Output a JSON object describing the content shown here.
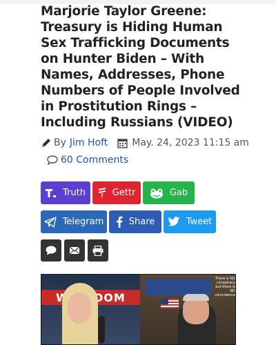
{
  "article": {
    "headline": "Marjorie Taylor Greene: Treasury is Hiding Human Sex Trafficking Documents on Hunter Biden – With Names, Addresses, Phone Numbers of People Involved in Prostitution Rings – Including Russians (VIDEO)",
    "byline_prefix": "By",
    "author": "Jim Hoft",
    "date": "May. 24, 2023 11:15 am",
    "comments": "60 Comments"
  },
  "share": {
    "truth": "Truth",
    "gettr": "Gettr",
    "gab": "Gab",
    "telegram": "Telegram",
    "share": "Share",
    "tweet": "Tweet"
  },
  "video": {
    "banner": "WELCOOM",
    "panel_text": "There is NO conspiracy but there is NO coincidence"
  },
  "colors": {
    "truth": "#5b3fd1",
    "gettr": "#e0242f",
    "gab": "#25b34b",
    "telegram": "#2b69b8",
    "facebook": "#2c5cb3",
    "twitter": "#1d9bf0",
    "link": "#2452a6",
    "dark_button": "#333333"
  },
  "icons": [
    "pencil-icon",
    "calendar-icon",
    "comment-bubble-icon",
    "truth-logo-icon",
    "gettr-logo-icon",
    "gab-frog-icon",
    "telegram-plane-icon",
    "facebook-f-icon",
    "twitter-bird-icon",
    "sms-bubble-icon",
    "email-icon",
    "print-icon"
  ]
}
